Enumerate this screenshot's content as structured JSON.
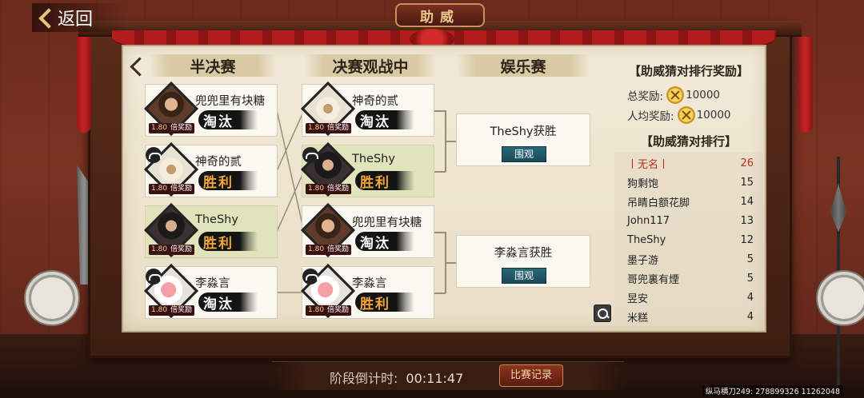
{
  "header": {
    "back_label": "返回",
    "title": "助威"
  },
  "columns": {
    "semifinal": "半决赛",
    "final": "决赛观战中",
    "exhibition": "娱乐赛"
  },
  "semifinal_cards": [
    {
      "name": "兜兜里有块糖",
      "odds": "1.80",
      "odds_label": "倍奖励",
      "result": "淘汰",
      "outcome": "lose"
    },
    {
      "name": "神奇的贰",
      "odds": "1.80",
      "odds_label": "倍奖励",
      "result": "胜利",
      "outcome": "win"
    },
    {
      "name": "TheShy",
      "odds": "1.80",
      "odds_label": "倍奖励",
      "result": "胜利",
      "outcome": "win"
    },
    {
      "name": "李淼言",
      "odds": "1.80",
      "odds_label": "倍奖励",
      "result": "淘汰",
      "outcome": "lose"
    }
  ],
  "final_cards": [
    {
      "name": "神奇的贰",
      "odds": "1.80",
      "odds_label": "倍奖励",
      "result": "淘汰",
      "outcome": "lose"
    },
    {
      "name": "TheShy",
      "odds": "1.80",
      "odds_label": "倍奖励",
      "result": "胜利",
      "outcome": "win"
    },
    {
      "name": "兜兜里有块糖",
      "odds": "1.80",
      "odds_label": "倍奖励",
      "result": "淘汰",
      "outcome": "lose"
    },
    {
      "name": "李淼言",
      "odds": "1.80",
      "odds_label": "倍奖励",
      "result": "胜利",
      "outcome": "win"
    }
  ],
  "results": [
    {
      "text": "TheShy获胜",
      "watch_label": "围观"
    },
    {
      "text": "李淼言获胜",
      "watch_label": "围观"
    }
  ],
  "ranking": {
    "reward_title": "【助威猜对排行奖励】",
    "total_label": "总奖励:",
    "total_value": "10000",
    "per_label": "人均奖励:",
    "per_value": "10000",
    "list_title": "【助威猜对排行】",
    "rows": [
      {
        "name": "丨无名丨",
        "score": "26"
      },
      {
        "name": "狗剩饱",
        "score": "15"
      },
      {
        "name": "吊睛白额花脚",
        "score": "14"
      },
      {
        "name": "John117",
        "score": "13"
      },
      {
        "name": "TheShy",
        "score": "12"
      },
      {
        "name": "墨子游",
        "score": "5"
      },
      {
        "name": "哥兜裏有煙",
        "score": "5"
      },
      {
        "name": "昱安",
        "score": "4"
      },
      {
        "name": "米糕",
        "score": "4"
      }
    ]
  },
  "footer": {
    "countdown_label": "阶段倒计时:",
    "countdown_value": "00:11:47",
    "record_label": "比赛记录"
  },
  "watermark": "纵马横刀249: 278899326 11262048",
  "colors": {
    "win_text": "#f3a73a",
    "rank_highlight": "#b3301e",
    "watch_button": "#2a6978",
    "curtain": "#b41d1d"
  }
}
